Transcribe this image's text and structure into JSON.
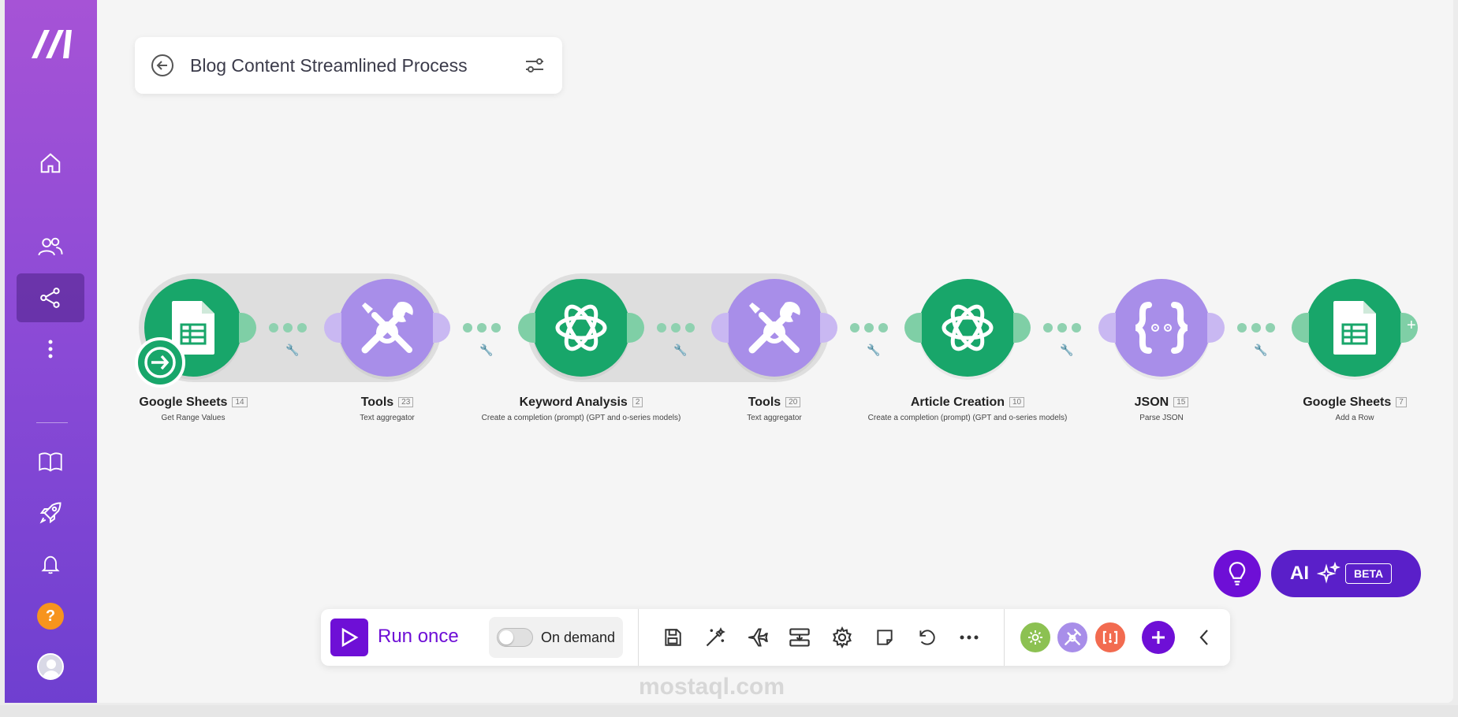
{
  "scenario": {
    "title": "Blog Content Streamlined Process"
  },
  "flow": {
    "modules": [
      {
        "name": "Google Sheets",
        "count": "14",
        "action": "Get Range Values",
        "app": "google-sheets"
      },
      {
        "name": "Tools",
        "count": "23",
        "action": "Text aggregator",
        "app": "tools"
      },
      {
        "name": "Keyword Analysis",
        "count": "2",
        "action": "Create a completion (prompt) (GPT and o-series models)",
        "app": "openai"
      },
      {
        "name": "Tools",
        "count": "20",
        "action": "Text aggregator",
        "app": "tools"
      },
      {
        "name": "Article Creation",
        "count": "10",
        "action": "Create a completion (prompt) (GPT and o-series models)",
        "app": "openai"
      },
      {
        "name": "JSON",
        "count": "15",
        "action": "Parse JSON",
        "app": "json"
      },
      {
        "name": "Google Sheets",
        "count": "7",
        "action": "Add a Row",
        "app": "google-sheets"
      }
    ]
  },
  "toolbar": {
    "run_label": "Run once",
    "schedule_label": "On demand"
  },
  "ai": {
    "label": "AI",
    "badge": "BETA"
  },
  "watermark": "mostaql.com",
  "colors": {
    "accent": "#6e0fd6",
    "green": "#18a66a",
    "purple": "#a88ee9"
  }
}
